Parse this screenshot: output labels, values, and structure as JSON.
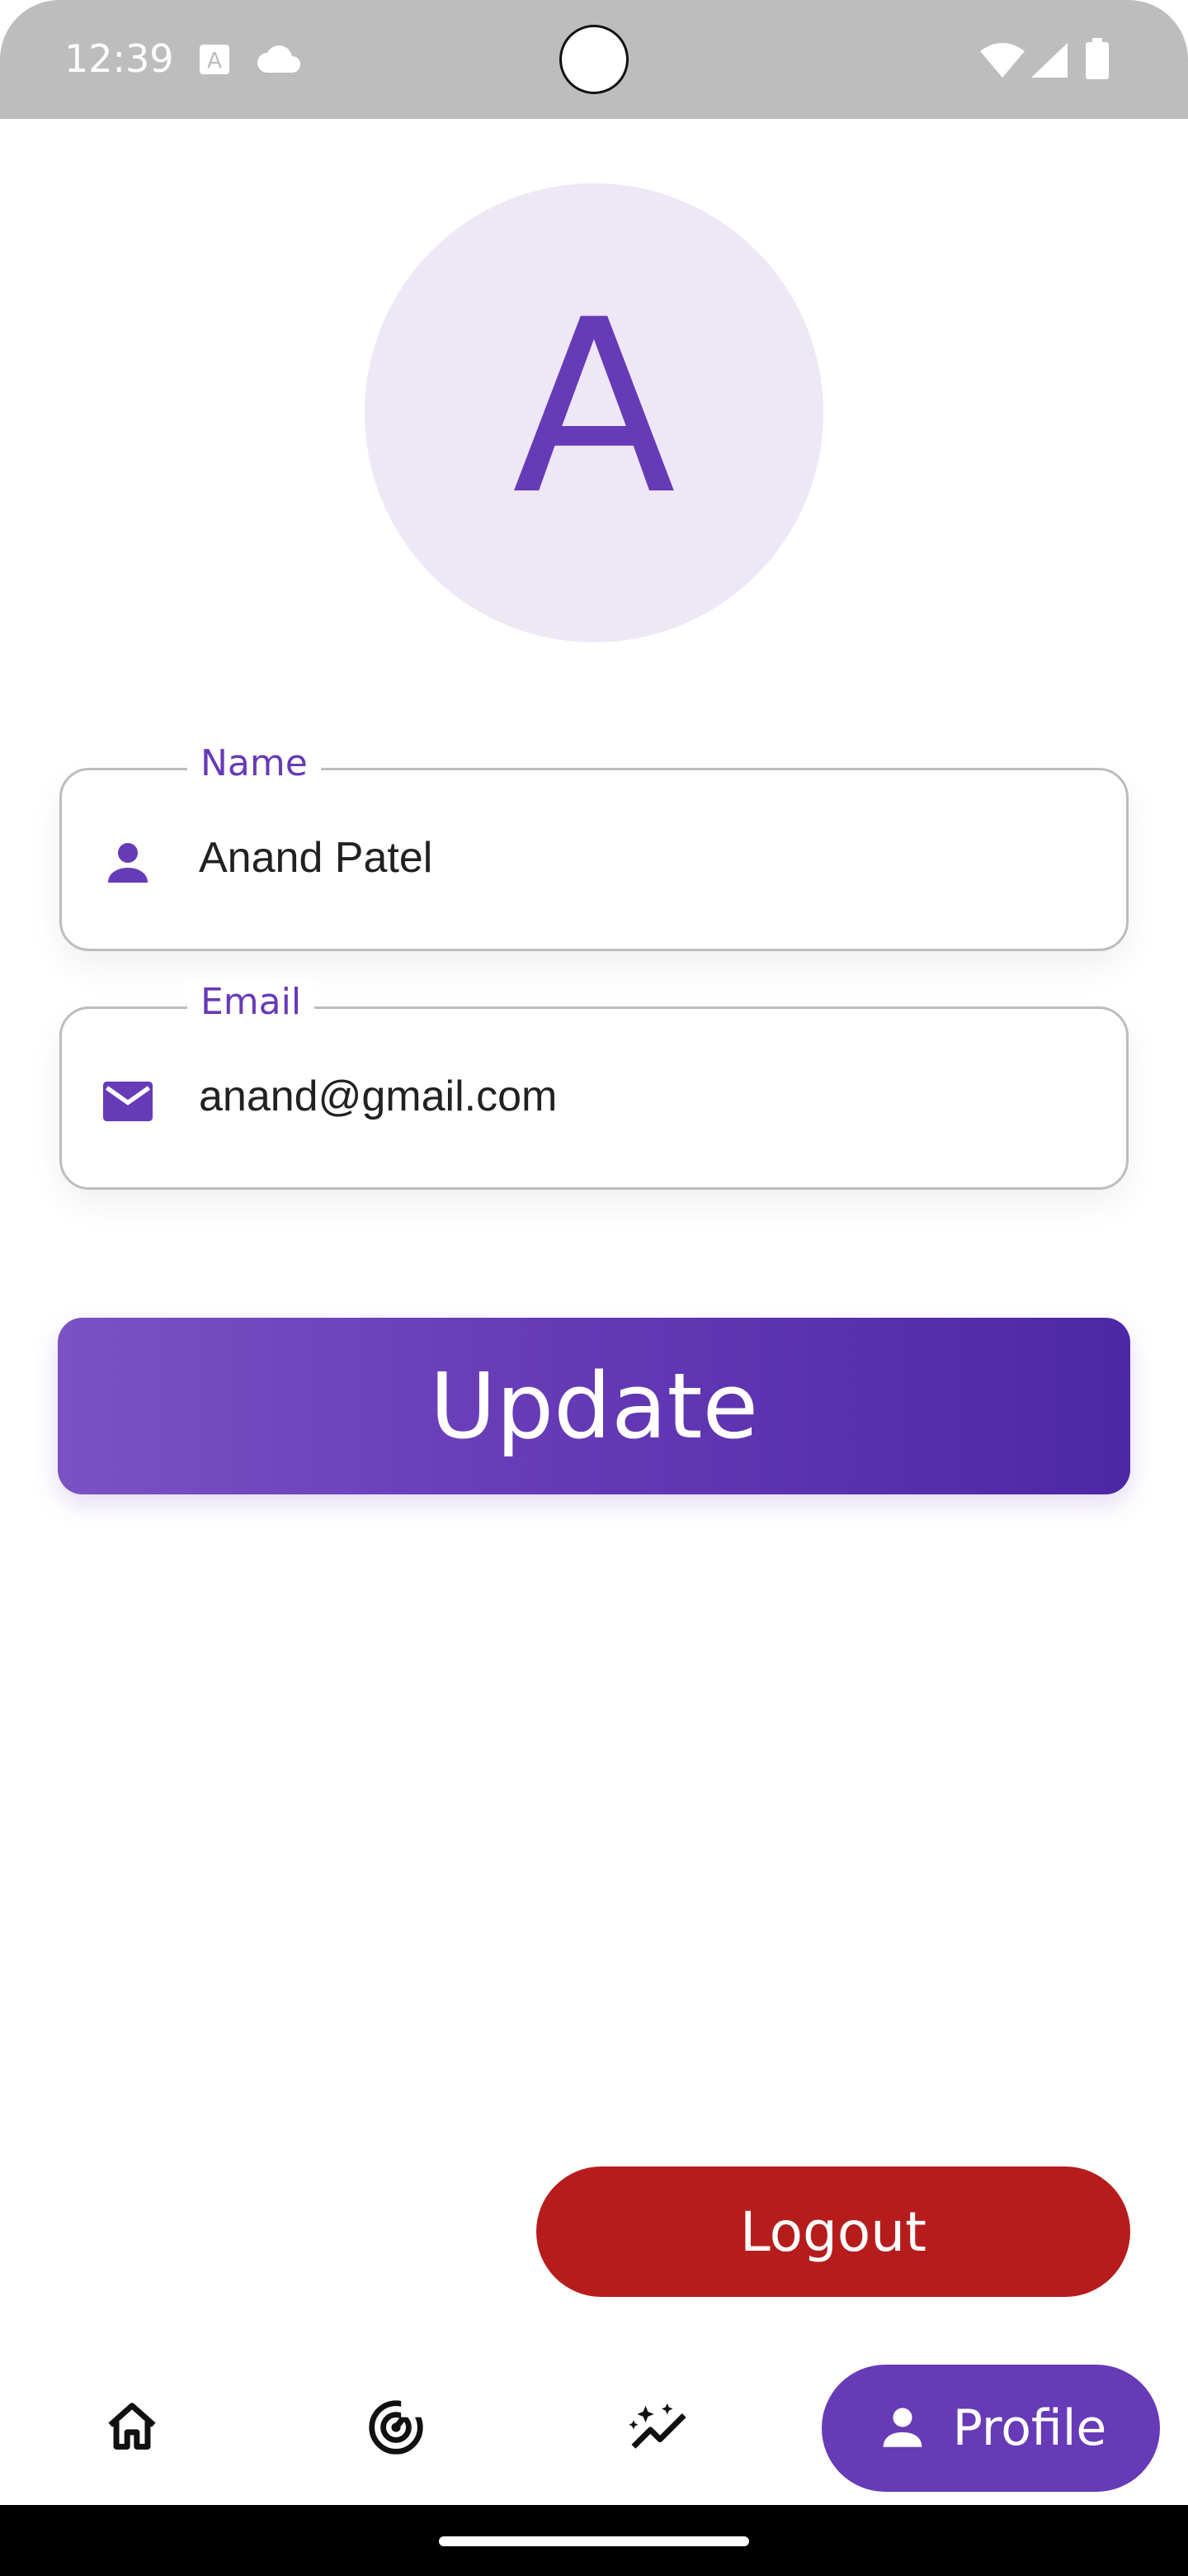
{
  "status_bar": {
    "time": "12:39",
    "icons": [
      "font-a-icon",
      "cloud-icon",
      "wifi-icon",
      "signal-icon",
      "battery-icon"
    ]
  },
  "profile": {
    "avatar_initial": "A",
    "name_label": "Name",
    "name_value": "Anand Patel",
    "email_label": "Email",
    "email_value": "anand@gmail.com",
    "update_label": "Update",
    "logout_label": "Logout"
  },
  "bottom_nav": {
    "items": [
      {
        "icon": "home-icon"
      },
      {
        "icon": "radar-icon"
      },
      {
        "icon": "insights-icon"
      },
      {
        "icon": "person-icon",
        "label": "Profile",
        "selected": true
      }
    ]
  },
  "colors": {
    "accent": "#673ab7",
    "avatar_bg": "#ede7f6",
    "logout": "#b71c1c",
    "status_bar": "#bdbdbd"
  }
}
